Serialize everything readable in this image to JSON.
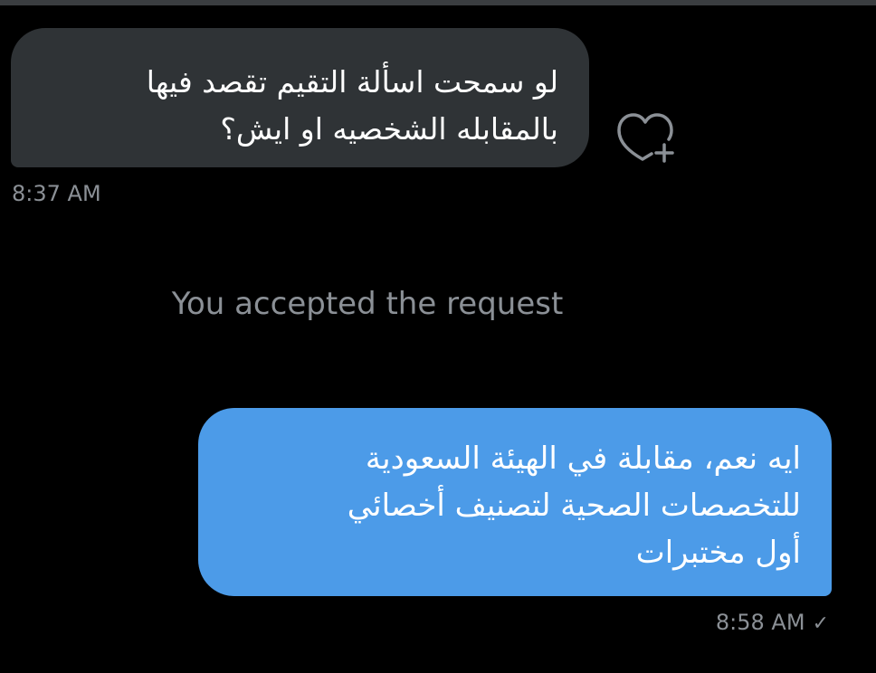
{
  "colors": {
    "background": "#000000",
    "incoming_bubble": "#2f3336",
    "outgoing_bubble": "#4c9be8",
    "muted_text": "#8b9096",
    "text": "#ffffff"
  },
  "messages": [
    {
      "direction": "incoming",
      "lines": [
        "لو سمحت اسألة التقيم تقصد فيها",
        "بالمقابله الشخصيه او ايش؟"
      ],
      "timestamp": "8:37 AM",
      "reaction_icon": "heart-plus-icon"
    },
    {
      "direction": "outgoing",
      "lines": [
        "ايه نعم، مقابلة في الهيئة السعودية",
        "للتخصصات الصحية لتصنيف أخصائي",
        "أول مختبرات"
      ],
      "timestamp": "8:58 AM",
      "status_icon": "checkmark-icon",
      "status_glyph": "✓"
    }
  ],
  "system_note": "You accepted the request"
}
